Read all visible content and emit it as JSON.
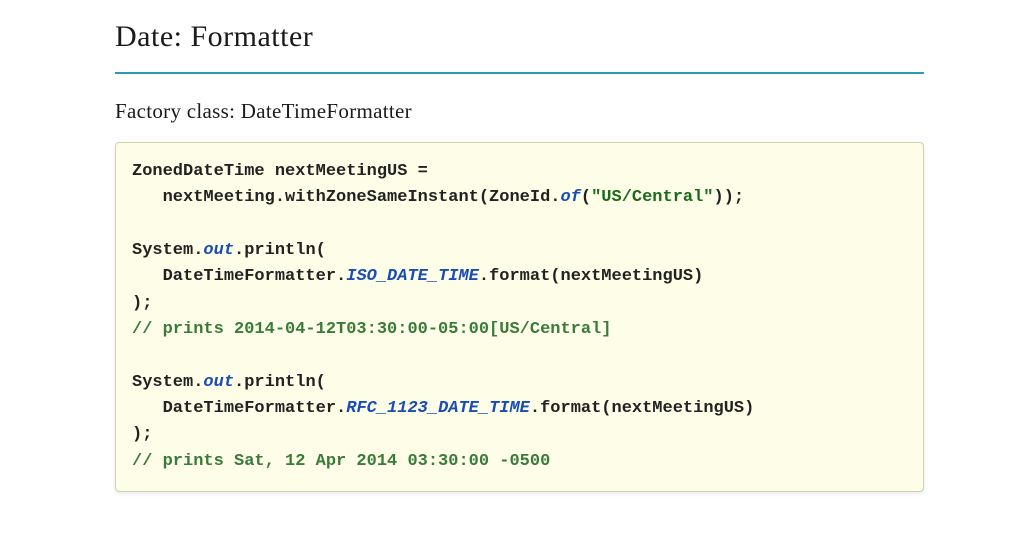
{
  "heading": "Date: Formatter",
  "subheading": "Factory class: DateTimeFormatter",
  "code": {
    "line1a": "ZonedDateTime nextMeetingUS =",
    "line2a": "   nextMeeting.withZoneSameInstant(ZoneId.",
    "line2_of": "of",
    "line2b": "(",
    "line2_str": "\"US/Central\"",
    "line2c": "));",
    "line4a": "System.",
    "line4_out": "out",
    "line4b": ".println(",
    "line5a": "   DateTimeFormatter.",
    "line5_iso": "ISO_DATE_TIME",
    "line5b": ".format(nextMeetingUS)",
    "line6": ");",
    "line7_comment": "// prints 2014-04-12T03:30:00-05:00[US/Central]",
    "line9a": "System.",
    "line9_out": "out",
    "line9b": ".println(",
    "line10a": "   DateTimeFormatter.",
    "line10_rfc": "RFC_1123_DATE_TIME",
    "line10b": ".format(nextMeetingUS)",
    "line11": ");",
    "line12_comment": "// prints Sat, 12 Apr 2014 03:30:00 -0500"
  }
}
